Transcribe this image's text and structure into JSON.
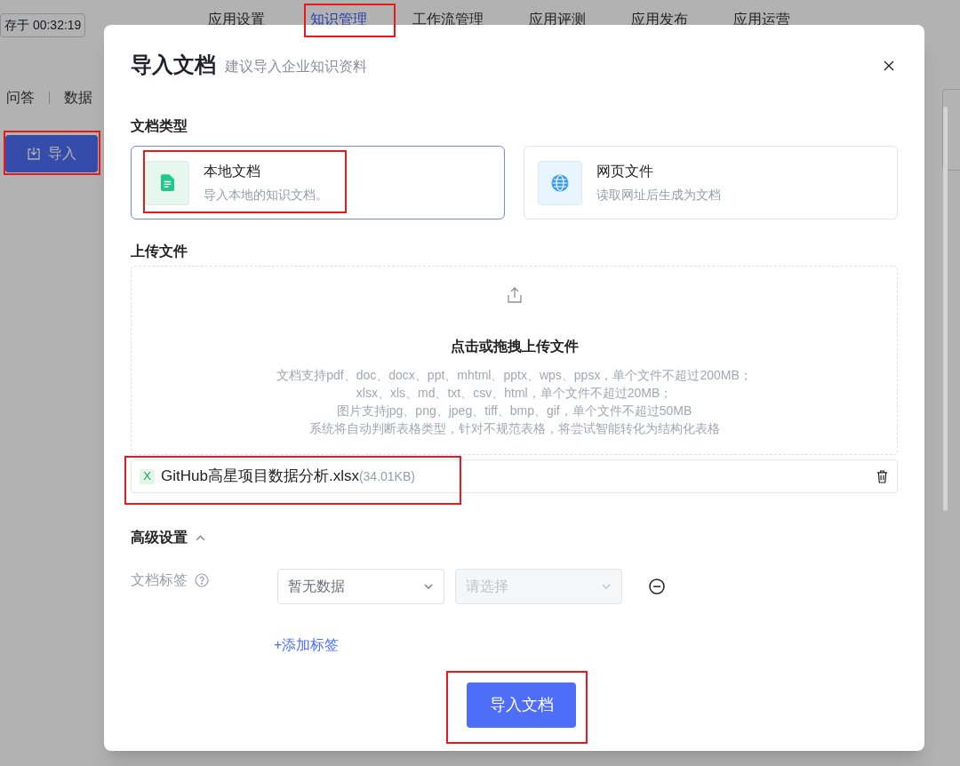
{
  "background": {
    "save_status": "存于 00:32:19",
    "nav_tabs": [
      {
        "label": "应用设置",
        "selected": false
      },
      {
        "label": "知识管理",
        "selected": true
      },
      {
        "label": "工作流管理",
        "selected": false
      },
      {
        "label": "应用评测",
        "selected": false
      },
      {
        "label": "应用发布",
        "selected": false
      },
      {
        "label": "应用运营",
        "selected": false
      }
    ],
    "sub_tabs": [
      "问答",
      "数据"
    ],
    "import_button": "导入"
  },
  "dialog": {
    "title": "导入文档",
    "subtitle": "建议导入企业知识资料",
    "doc_type_label": "文档类型",
    "doc_types": [
      {
        "kind": "local",
        "title": "本地文档",
        "description": "导入本地的知识文档。",
        "selected": true
      },
      {
        "kind": "web",
        "title": "网页文件",
        "description": "读取网址后生成为文档",
        "selected": false
      }
    ],
    "upload_label": "上传文件",
    "dropzone": {
      "title": "点击或拖拽上传文件",
      "hints": [
        "文档支持pdf、doc、docx、ppt、mhtml、pptx、wps、ppsx，单个文件不超过200MB；",
        "xlsx、xls、md、txt、csv、html，单个文件不超过20MB；",
        "图片支持jpg、png、jpeg、tiff、bmp、gif，单个文件不超过50MB",
        "系统将自动判断表格类型，针对不规范表格，将尝试智能转化为结构化表格"
      ]
    },
    "files": [
      {
        "badge": "X",
        "name": "GitHub高星项目数据分析.xlsx",
        "size": "(34.01KB)"
      }
    ],
    "advanced": {
      "label": "高级设置",
      "expanded": true,
      "tag_label": "文档标签",
      "tag_select": {
        "value": "暂无数据"
      },
      "tag_value_select": {
        "placeholder": "请选择",
        "disabled": true
      },
      "add_tag": "+添加标签"
    },
    "submit": "导入文档"
  }
}
